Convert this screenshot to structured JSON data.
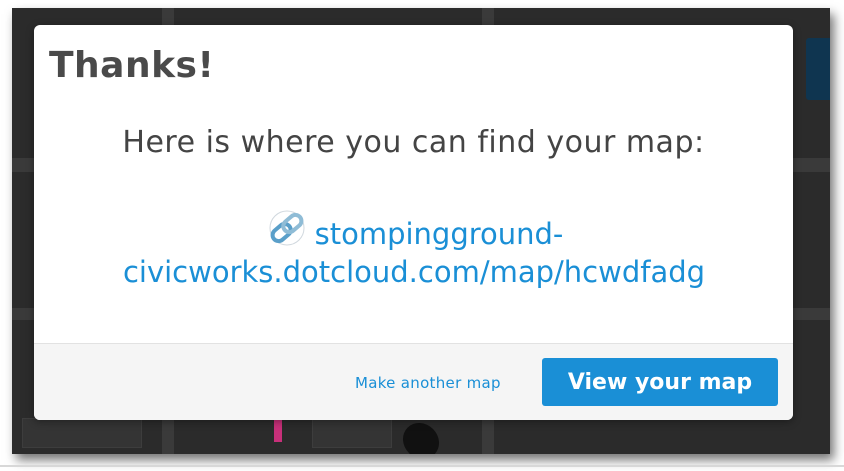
{
  "modal": {
    "title": "Thanks!",
    "message": "Here is where you can find your map:",
    "link_line1": "stompingground-",
    "link_line2": "civicworks.dotcloud.com/map/hcwdfadg",
    "link_icon": "chain-link-icon"
  },
  "footer": {
    "another_map_label": "Make another map",
    "view_button_label": "View your map"
  },
  "colors": {
    "accent": "#1a8fd6",
    "title_text": "#4a4a4a",
    "backdrop": "#2b2b2b"
  }
}
